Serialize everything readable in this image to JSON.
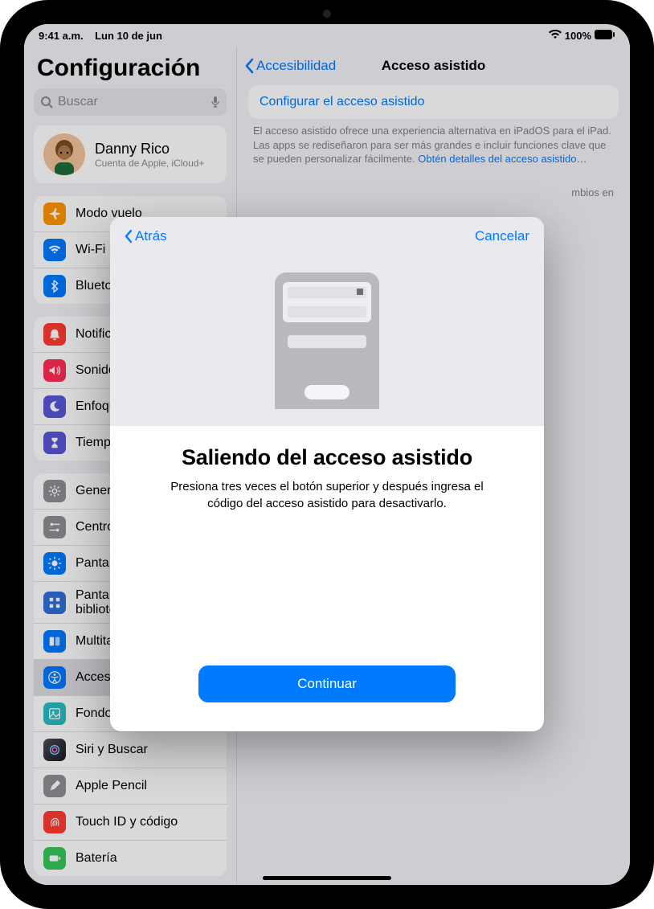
{
  "status": {
    "time": "9:41 a.m.",
    "date": "Lun 10 de jun",
    "battery": "100%"
  },
  "sidebar": {
    "title": "Configuración",
    "search_placeholder": "Buscar",
    "profile": {
      "name": "Danny Rico",
      "subtitle": "Cuenta de Apple, iCloud+"
    },
    "groups": [
      {
        "items": [
          {
            "label": "Modo vuelo",
            "icon": "airplane-icon",
            "color": "#ff9500"
          },
          {
            "label": "Wi-Fi",
            "icon": "wifi-icon",
            "color": "#007aff"
          },
          {
            "label": "Bluetooth",
            "icon": "bluetooth-icon",
            "color": "#007aff"
          }
        ]
      },
      {
        "items": [
          {
            "label": "Notificaciones",
            "icon": "bell-icon",
            "color": "#ff3b30"
          },
          {
            "label": "Sonidos",
            "icon": "speaker-icon",
            "color": "#ff2d55"
          },
          {
            "label": "Enfoque",
            "icon": "moon-icon",
            "color": "#5856d6"
          },
          {
            "label": "Tiempo en pantalla",
            "icon": "hourglass-icon",
            "color": "#5856d6"
          }
        ]
      },
      {
        "items": [
          {
            "label": "General",
            "icon": "gear-icon",
            "color": "#8e8e93"
          },
          {
            "label": "Centro de control",
            "icon": "switches-icon",
            "color": "#8e8e93"
          },
          {
            "label": "Pantalla y brillo",
            "icon": "brightness-icon",
            "color": "#007aff"
          },
          {
            "label": "Pantalla de inicio y biblioteca de apps",
            "icon": "grid-icon",
            "color": "#2f6fdb"
          },
          {
            "label": "Multitarea y gestos",
            "icon": "multitask-icon",
            "color": "#007aff"
          },
          {
            "label": "Accesibilidad",
            "icon": "accessibility-icon",
            "color": "#007aff",
            "selected": true
          },
          {
            "label": "Fondo de pantalla",
            "icon": "wallpaper-icon",
            "color": "#29bbc2"
          },
          {
            "label": "Siri y Buscar",
            "icon": "siri-icon",
            "color": "#212124"
          },
          {
            "label": "Apple Pencil",
            "icon": "pencil-icon",
            "color": "#8e8e93"
          },
          {
            "label": "Touch ID y código",
            "icon": "fingerprint-icon",
            "color": "#ff3b30"
          },
          {
            "label": "Batería",
            "icon": "battery-icon",
            "color": "#34c759"
          }
        ]
      }
    ]
  },
  "content": {
    "back": "Accesibilidad",
    "title": "Acceso asistido",
    "configure": "Configurar el acceso asistido",
    "description": "El acceso asistido ofrece una experiencia alternativa en iPadOS para el iPad. Las apps se rediseñaron para ser más grandes e incluir funciones clave que se pueden personalizar fácilmente. ",
    "learn_more": "Obtén detalles del acceso asistido…",
    "hidden_trail": "mbios en"
  },
  "modal": {
    "back": "Atrás",
    "cancel": "Cancelar",
    "title": "Saliendo del acceso asistido",
    "body": "Presiona tres veces el botón superior y después ingresa el código del acceso asistido para desactivarlo.",
    "continue": "Continuar"
  }
}
